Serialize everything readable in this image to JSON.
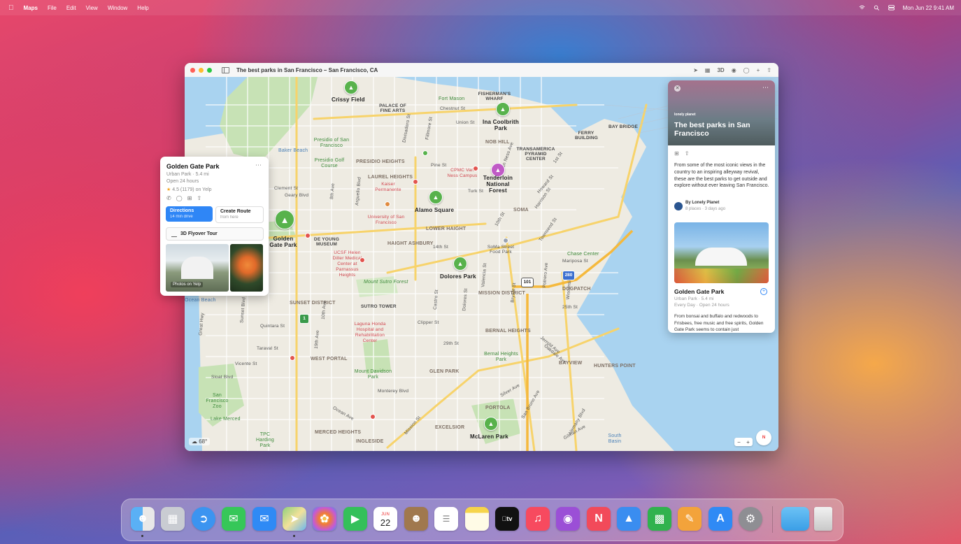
{
  "menubar": {
    "app": "Maps",
    "items": [
      "File",
      "Edit",
      "View",
      "Window",
      "Help"
    ],
    "clock": "Mon Jun 22  9:41 AM"
  },
  "window": {
    "title": "The best parks in San Francisco  –  San Francisco, CA",
    "toolbar": {
      "view_3d": "3D"
    }
  },
  "map": {
    "neighborhoods": [
      "PRESIDIO HEIGHTS",
      "LAUREL HEIGHTS",
      "HAIGHT ASHBURY",
      "LOWER HAIGHT",
      "NOB HILL",
      "SOMA",
      "MISSION DISTRICT",
      "SUNSET DISTRICT",
      "WEST PORTAL",
      "GLEN PARK",
      "BERNAL HEIGHTS",
      "BAYVIEW",
      "HUNTERS POINT",
      "DOGPATCH",
      "PORTOLA",
      "EXCELSIOR",
      "INGLESIDE",
      "MERCED HEIGHTS"
    ],
    "parks": {
      "crissy": "Crissy Field",
      "ina": "Ina Coolbrith Park",
      "alamo": "Alamo Square",
      "golden": "Golden Gate Park",
      "dolores": "Dolores Park",
      "mclaren": "McLaren Park",
      "tenderloin": "Tenderloin National Forest"
    },
    "pois": {
      "palace": "PALACE OF FINE ARTS",
      "fisherman": "FISHERMAN'S WHARF",
      "transamerica": "TRANSAMERICA PYRAMID CENTER",
      "ferry": "FERRY BUILDING",
      "baybridge": "BAY BRIDGE",
      "deyoung": "DE YOUNG MUSEUM",
      "sutro": "SUTRO TOWER"
    },
    "green_labels": [
      "Fort Mason",
      "Presidio of San Francisco",
      "Presidio Golf Course",
      "Mount Sutro Forest",
      "Chase Center",
      "Mount Davidson Park",
      "Bernal Heights Park",
      "San Francisco Zoo",
      "Lake Merced",
      "TPC Harding Park"
    ],
    "red_labels": [
      "Kaiser Permanente",
      "University of San Francisco",
      "CPMC Van Ness Campus",
      "UCSF Helen Diller Medical Center at Parnassus Heights",
      "Laguna Honda Hospital and Rehabilitation Center"
    ],
    "blue_labels": [
      "Baker Beach",
      "Ocean Beach",
      "South Basin"
    ],
    "streets": [
      "Chestnut St",
      "Union St",
      "Divisadero St",
      "Fillmore St",
      "Pine St",
      "Turk St",
      "Geary Blvd",
      "Clement St",
      "Arguello Blvd",
      "8th Ave",
      "14th St",
      "Clipper St",
      "29th St",
      "Monterey Blvd",
      "Ocean Ave",
      "Sloat Blvd",
      "Vicente St",
      "Taraval St",
      "Quintara St",
      "Sunset Blvd",
      "19th Ave",
      "Van Ness Ave",
      "Howard St",
      "1st St",
      "10th St",
      "Harrison St",
      "Townsend St",
      "Mariposa St",
      "25th St",
      "Potrero Ave",
      "Bryant St",
      "Castro St",
      "Dolores St",
      "Valencia St",
      "Jerrold Ave",
      "Oakdale Ave",
      "Silver Ave",
      "San Bruno Ave",
      "Gilman Ave",
      "Mission St",
      "Alemany Blvd",
      "10th Ave",
      "Great Hwy",
      "Wisconsin St",
      "SoMa Street Food Park"
    ],
    "shields": [
      "101",
      "280",
      "1"
    ],
    "weather": "68°"
  },
  "place_card": {
    "title": "Golden Gate Park",
    "subtitle": "Urban Park · 5.4 mi",
    "hours": "Open 24 hours",
    "rating": "4.5",
    "rating_rest": "(1179) on Yelp",
    "directions": {
      "label": "Directions",
      "sub": "14 min drive"
    },
    "route": {
      "label": "Create Route",
      "sub": "from here"
    },
    "flyover": "3D Flyover Tour",
    "photo_caption": "Photos on Yelp"
  },
  "guide": {
    "brand": "lonely planet",
    "title": "The best parks in San Francisco",
    "description": "From some of the most iconic views in the country to an inspiring alleyway revival, these are the best parks to get outside and explore without ever leaving San Francisco.",
    "author": "By Lonely Planet",
    "meta": "8 places · 3 days ago",
    "item": {
      "title": "Golden Gate Park",
      "subtitle": "Urban Park · 5.4 mi",
      "hours": "Every Day · Open 24 hours",
      "description": "From bonsai and buffalo and redwoods to Frisbees, free music and free spirits, Golden Gate Park seems to contain just"
    }
  },
  "dock": {
    "items": [
      {
        "name": "finder",
        "color": "#3b8de6"
      },
      {
        "name": "launchpad",
        "color": "#9aa0a8"
      },
      {
        "name": "safari",
        "color": "#2a8df0"
      },
      {
        "name": "messages",
        "color": "#36c759"
      },
      {
        "name": "mail",
        "color": "#2f8af5"
      },
      {
        "name": "maps",
        "color": "#5fb85a"
      },
      {
        "name": "photos",
        "color": "#f0f0f0"
      },
      {
        "name": "facetime",
        "color": "#34c05a"
      },
      {
        "name": "calendar",
        "color": "#ffffff"
      },
      {
        "name": "contacts",
        "color": "#a0784e"
      },
      {
        "name": "reminders",
        "color": "#ffffff"
      },
      {
        "name": "notes",
        "color": "#f6d44a"
      },
      {
        "name": "tv",
        "color": "#111111"
      },
      {
        "name": "music",
        "color": "#f74a5f"
      },
      {
        "name": "podcasts",
        "color": "#9b4fd6"
      },
      {
        "name": "news",
        "color": "#f24a5a"
      },
      {
        "name": "keynote",
        "color": "#3a8df0"
      },
      {
        "name": "numbers",
        "color": "#30b24e"
      },
      {
        "name": "pages",
        "color": "#f3a33b"
      },
      {
        "name": "app-store",
        "color": "#2f8af5"
      },
      {
        "name": "system-preferences",
        "color": "#8e8e93"
      }
    ],
    "calendar_month": "JUN",
    "calendar_day": "22",
    "tv_label": "tv"
  }
}
